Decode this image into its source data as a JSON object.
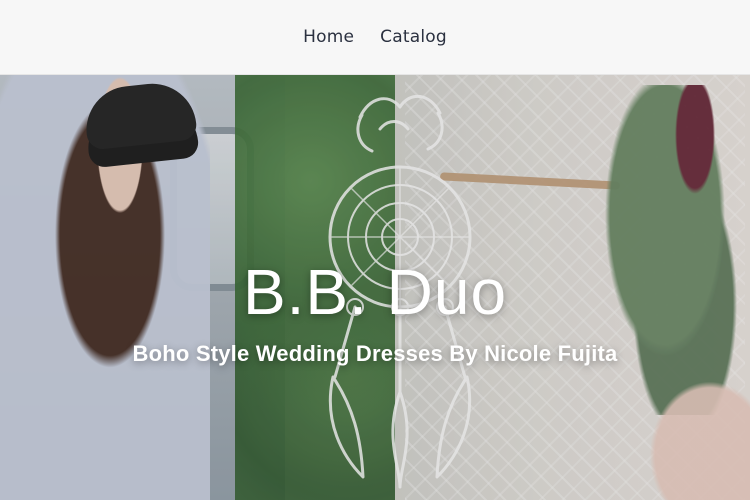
{
  "header": {
    "nav": [
      {
        "label": "Home"
      },
      {
        "label": "Catalog"
      }
    ]
  },
  "hero": {
    "title": "B.B. Duo",
    "subtitle": "Boho Style Wedding Dresses By Nicole Fujita"
  },
  "colors": {
    "header_bg": "#f7f7f7",
    "nav_text": "#2b3140",
    "hero_text": "#ffffff"
  }
}
